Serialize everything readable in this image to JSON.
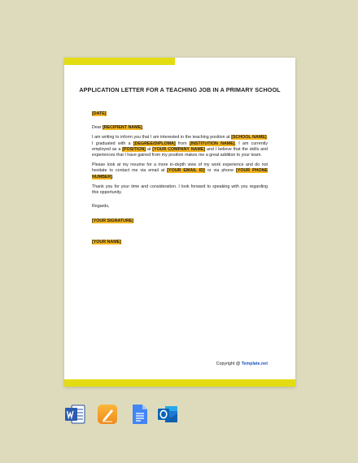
{
  "document": {
    "title": "APPLICATION LETTER FOR A TEACHING JOB IN A PRIMARY SCHOOL",
    "date": "[DATE]",
    "salutation_prefix": "Dear ",
    "recipient_name": "[RECIPIENT NAME]",
    "salutation_suffix": ",",
    "p1_a": "I am writing to inform you that I am interested in the teaching position at ",
    "school_name": "[SCHOOL NAME]",
    "p1_b": ". I graduated with a ",
    "degree": "[DEGREE/DIPLOMA]",
    "p1_c": " from ",
    "institution": "[INSTITUTION NAME]",
    "p1_d": ". I am currently employed as a ",
    "position": "[POSITION]",
    "p1_e": " at ",
    "company": "[YOUR COMPANY NAME]",
    "p1_f": " and I believe that the skills and experiences that I have gained from my position makes me a great addition to your team.",
    "p2_a": "Please look at my resume for a more in-depth view of my work experience and do not hesitate to contact me via email at ",
    "email": "[YOUR EMAIL ID]",
    "p2_b": " or via phone ",
    "phone": "[YOUR PHONE NUMBER]",
    "p2_c": ".",
    "p3": "Thank you for your time and consideration. I look forward to speaking with you regarding this opportunity.",
    "closing": "Regards,",
    "signature": "[YOUR SIGNATURE]",
    "name": "[YOUR NAME]",
    "copyright_prefix": "Copyright @ ",
    "copyright_brand": "Template.net"
  },
  "colors": {
    "accent_bar": "#e3dc12",
    "highlight": "#f2b41e",
    "background": "#dedbbd"
  },
  "app_icons": [
    "word-icon",
    "pages-icon",
    "google-docs-icon",
    "outlook-icon"
  ]
}
